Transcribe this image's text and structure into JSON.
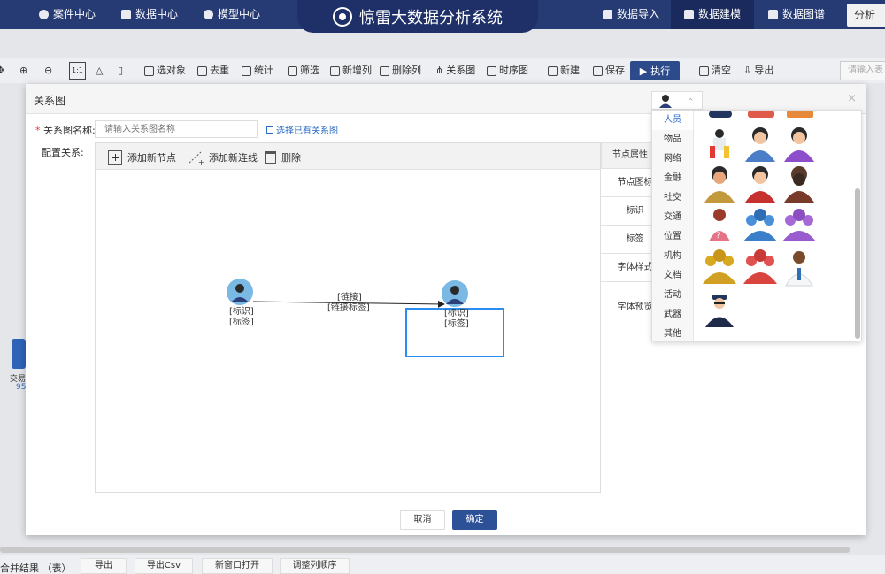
{
  "nav": {
    "case_center": "案件中心",
    "data_center": "数据中心",
    "model_center": "模型中心",
    "app_title": "惊雷大数据分析系统",
    "data_import": "数据导入",
    "data_modeling": "数据建模",
    "data_graph": "数据图谱",
    "right_btn": "分析"
  },
  "toolbar": {
    "select_object": "选对象",
    "dedup": "去重",
    "stats": "统计",
    "filter": "筛选",
    "add_column": "新增列",
    "delete_column": "删除列",
    "relation_graph": "关系图",
    "timeline": "时序图",
    "new": "新建",
    "save": "保存",
    "execute": "执行",
    "clear": "清空",
    "export": "导出",
    "search_placeholder": "请输入表",
    "ratio_label": "1:1"
  },
  "side": {
    "label": "交易",
    "count": "95"
  },
  "dialog": {
    "title": "关系图",
    "close": "×",
    "name_label": "关系图名称:",
    "name_required": "*",
    "name_placeholder": "请输入关系图名称",
    "pick_existing": "选择已有关系图",
    "config_label": "配置关系:",
    "add_node": "添加新节点",
    "add_link": "添加新连线",
    "delete": "删除",
    "props_title": "节点属性",
    "prop_rows": [
      "节点图标",
      "标识",
      "标签",
      "字体样式",
      "字体预览"
    ],
    "node1": {
      "id": "[标识]",
      "tag": "[标签]"
    },
    "node2": {
      "id": "[标识]",
      "tag": "[标签]"
    },
    "edge": {
      "line1": "[链接]",
      "line2": "[链接标签]"
    },
    "cancel": "取消",
    "ok": "确定"
  },
  "icon_picker": {
    "categories": [
      "人员",
      "物品",
      "网络",
      "金融",
      "社交",
      "交通",
      "位置",
      "机构",
      "文档",
      "活动",
      "武器",
      "其他"
    ],
    "active": "人员"
  },
  "bottom": {
    "merge_result": "合并结果 （表）",
    "export": "导出",
    "export_csv": "导出Csv",
    "open_new_window": "新窗口打开",
    "adjust_order": "调整列顺序"
  },
  "colors": {
    "nav": "#263a73",
    "primary": "#2d5196",
    "selection": "#2b8df0"
  }
}
